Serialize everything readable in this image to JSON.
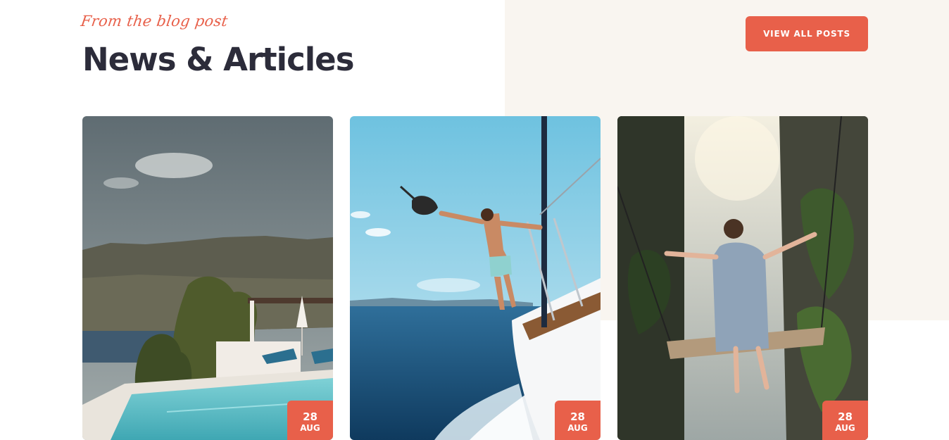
{
  "section": {
    "tagline": "From the blog post",
    "title": "News & Articles",
    "view_all_label": "VIEW ALL POSTS"
  },
  "cards": [
    {
      "day": "28",
      "month": "AUG",
      "image": "resort-pool-by-mountains"
    },
    {
      "day": "28",
      "month": "AUG",
      "image": "man-leaping-from-sailboat"
    },
    {
      "day": "28",
      "month": "AUG",
      "image": "woman-on-swing-at-waterfall"
    }
  ],
  "colors": {
    "accent": "#e8604a",
    "heading": "#2c2c3a",
    "panel": "#f9f5f0"
  }
}
